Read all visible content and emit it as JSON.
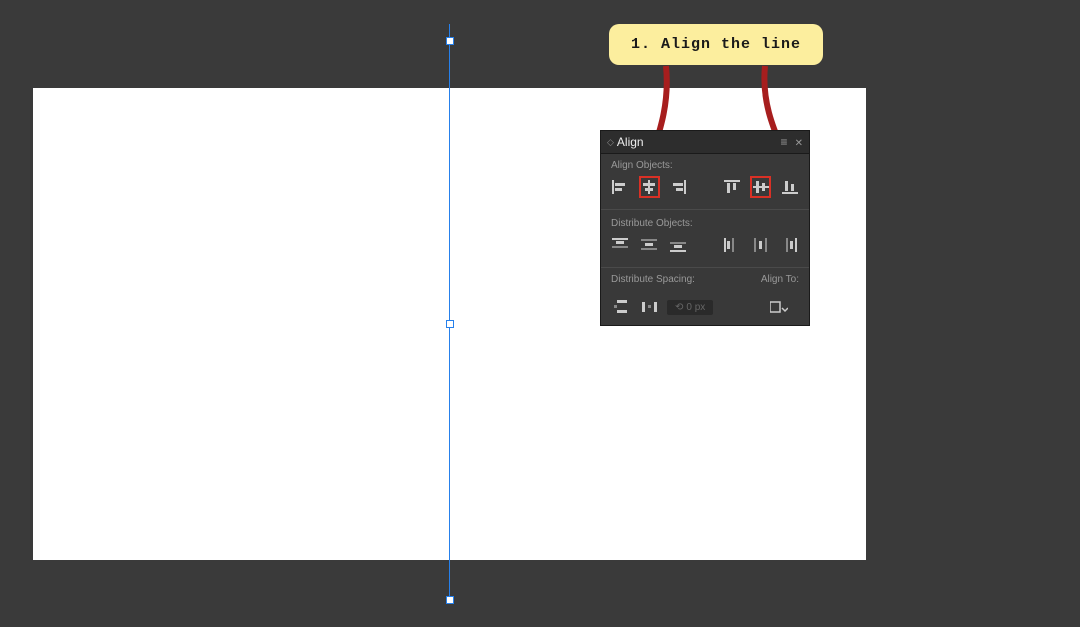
{
  "callout": {
    "text": "1. Align the line"
  },
  "panel": {
    "tab_title": "Align",
    "sections": {
      "align_objects": "Align Objects:",
      "distribute_objects": "Distribute Objects:",
      "distribute_spacing": "Distribute Spacing:",
      "align_to": "Align To:"
    },
    "spacing_value": "0 px",
    "align_buttons": {
      "horizontal_left": "Horizontal Align Left",
      "horizontal_center": "Horizontal Align Center",
      "horizontal_right": "Horizontal Align Right",
      "vertical_top": "Vertical Align Top",
      "vertical_center": "Vertical Align Center",
      "vertical_bottom": "Vertical Align Bottom"
    },
    "distribute_buttons": {
      "v_top": "Vertical Distribute Top",
      "v_center": "Vertical Distribute Center",
      "v_bottom": "Vertical Distribute Bottom",
      "h_left": "Horizontal Distribute Left",
      "h_center": "Horizontal Distribute Center",
      "h_right": "Horizontal Distribute Right"
    }
  }
}
